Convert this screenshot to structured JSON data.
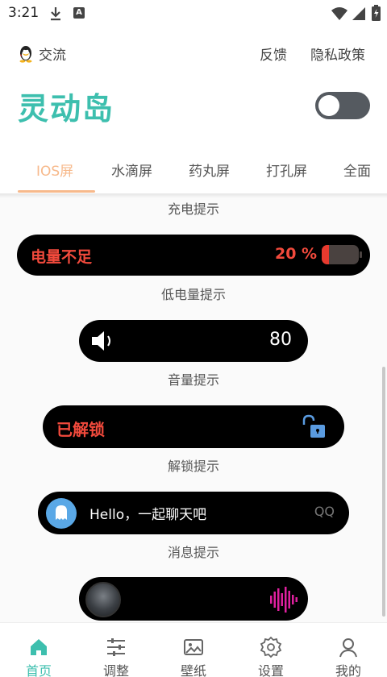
{
  "status_bar": {
    "time": "3:21"
  },
  "header": {
    "qq_link": "交流",
    "feedback": "反馈",
    "privacy": "隐私政策",
    "app_title": "灵动岛",
    "main_toggle_on": false
  },
  "tabs": [
    {
      "label": "IOS屏",
      "active": true
    },
    {
      "label": "水滴屏",
      "active": false
    },
    {
      "label": "药丸屏",
      "active": false
    },
    {
      "label": "打孔屏",
      "active": false
    },
    {
      "label": "全面",
      "active": false
    }
  ],
  "content": {
    "charging_caption": "充电提示",
    "low_battery": {
      "text": "电量不足",
      "percent_label": "20 %",
      "level": 0.2
    },
    "low_battery_caption": "低电量提示",
    "volume": {
      "value": "80"
    },
    "volume_caption": "音量提示",
    "unlock": {
      "text": "已解锁"
    },
    "unlock_caption": "解锁提示",
    "message": {
      "text": "Hello，一起聊天吧",
      "source": "QQ"
    },
    "message_caption": "消息提示"
  },
  "colors": {
    "accent": "#3dbfae",
    "tab_active": "#f7b98b",
    "alert_red": "#f24a3c",
    "wave_magenta": "#e0209f"
  },
  "bottom_nav": [
    {
      "label": "首页",
      "icon": "home-icon",
      "active": true
    },
    {
      "label": "调整",
      "icon": "sliders-icon",
      "active": false
    },
    {
      "label": "壁纸",
      "icon": "image-icon",
      "active": false
    },
    {
      "label": "设置",
      "icon": "gear-icon",
      "active": false
    },
    {
      "label": "我的",
      "icon": "user-icon",
      "active": false
    }
  ]
}
